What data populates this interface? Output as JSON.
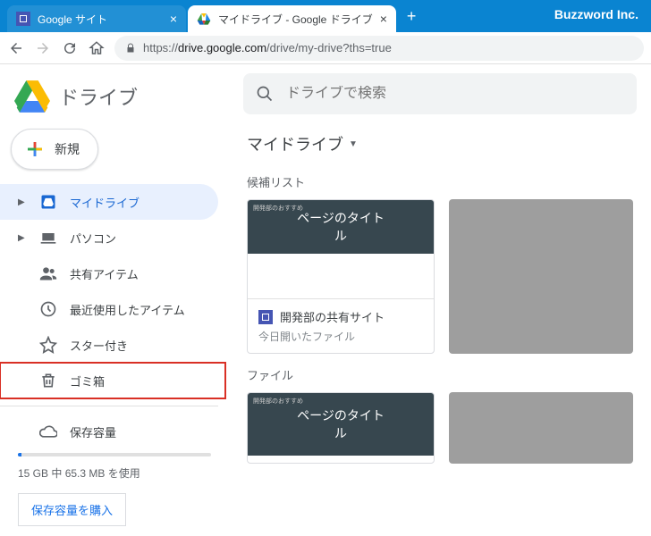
{
  "browser": {
    "brand": "Buzzword Inc.",
    "tabs": [
      {
        "title": "Google サイト",
        "active": false
      },
      {
        "title": "マイドライブ - Google ドライブ",
        "active": true
      }
    ],
    "url": {
      "proto": "https://",
      "host": "drive.google.com",
      "path": "/drive/my-drive?ths=true"
    }
  },
  "drive": {
    "app_title": "ドライブ",
    "new_button": "新規",
    "search_placeholder": "ドライブで検索",
    "nav": {
      "mydrive": "マイドライブ",
      "computers": "パソコン",
      "shared": "共有アイテム",
      "recent": "最近使用したアイテム",
      "starred": "スター付き",
      "trash": "ゴミ箱",
      "storage": "保存容量"
    },
    "storage_text": "15 GB 中 65.3 MB を使用",
    "buy_storage": "保存容量を購入",
    "breadcrumb": "マイドライブ",
    "suggested_label": "候補リスト",
    "files_label": "ファイル",
    "card": {
      "thumb_tiny": "開発部のおすすめ",
      "thumb_title_l1": "ページのタイト",
      "thumb_title_l2": "ル",
      "title": "開発部の共有サイト",
      "subtitle": "今日開いたファイル"
    }
  }
}
